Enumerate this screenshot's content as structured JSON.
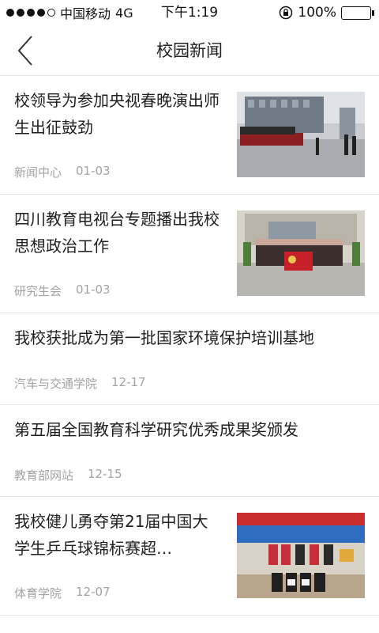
{
  "status_bar": {
    "carrier": "中国移动",
    "network": "4G",
    "time": "下午1:19",
    "battery": "100%"
  },
  "nav": {
    "title": "校园新闻",
    "back_icon": "chevron-left-icon"
  },
  "news": [
    {
      "title": "校领导为参加央视春晚演出师生出征鼓劲",
      "source": "新闻中心",
      "date": "01-03",
      "has_image": true,
      "image_desc_icon": "photo-crowd-steps"
    },
    {
      "title": "四川教育电视台专题播出我校思想政治工作",
      "source": "研究生会",
      "date": "01-03",
      "has_image": true,
      "image_desc_icon": "photo-group-banner"
    },
    {
      "title": "我校获批成为第一批国家环境保护培训基地",
      "source": "汽车与交通学院",
      "date": "12-17",
      "has_image": false
    },
    {
      "title": "第五届全国教育科学研究优秀成果奖颁发",
      "source": "教育部网站",
      "date": "12-15",
      "has_image": false
    },
    {
      "title": "我校健儿勇夺第21届中国大学生乒乓球锦标赛超…",
      "source": "体育学院",
      "date": "12-07",
      "has_image": true,
      "image_desc_icon": "photo-team-awards"
    }
  ],
  "colors": {
    "text_primary": "#1f1f1f",
    "text_meta": "#a3a3a3",
    "divider": "#e6e6e6",
    "background": "#ffffff"
  }
}
